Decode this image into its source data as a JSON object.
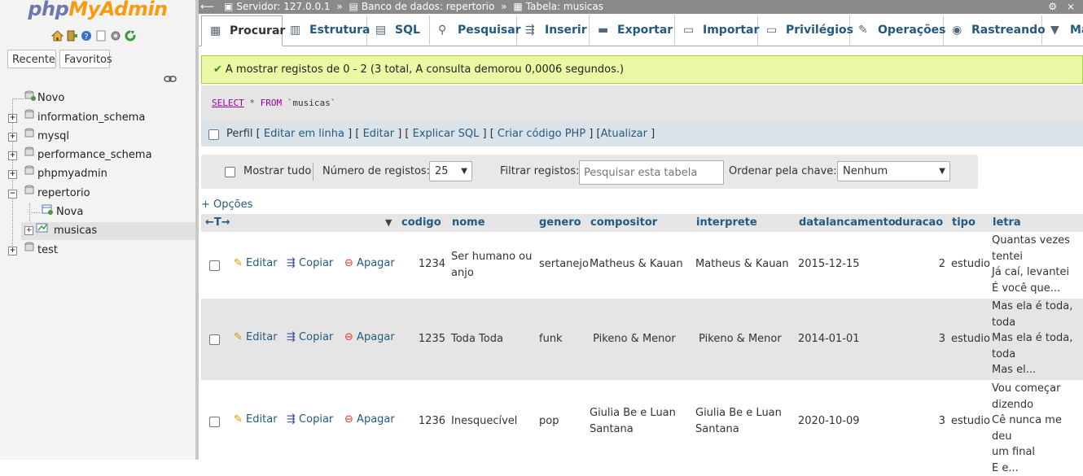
{
  "sidebar": {
    "logo_php": "php",
    "logo_myadmin": "MyAdmin",
    "recent_tab": "Recente",
    "favorites_tab": "Favoritos",
    "tree": [
      {
        "label": "Novo"
      },
      {
        "label": "information_schema"
      },
      {
        "label": "mysql"
      },
      {
        "label": "performance_schema"
      },
      {
        "label": "phpmyadmin"
      },
      {
        "label": "repertorio"
      },
      {
        "label": "Nova"
      },
      {
        "label": "musicas"
      },
      {
        "label": "test"
      }
    ]
  },
  "breadcrumb": {
    "server": "Servidor: 127.0.0.1",
    "database": "Banco de dados: repertorio",
    "table": "Tabela: musicas",
    "sep": "»"
  },
  "tabs": [
    {
      "label": "Procurar"
    },
    {
      "label": "Estrutura"
    },
    {
      "label": "SQL"
    },
    {
      "label": "Pesquisar"
    },
    {
      "label": "Inserir"
    },
    {
      "label": "Exportar"
    },
    {
      "label": "Importar"
    },
    {
      "label": "Privilégios"
    },
    {
      "label": "Operações"
    },
    {
      "label": "Rastreando"
    },
    {
      "label": "Ma"
    }
  ],
  "message": "A mostrar registos de 0 - 2 (3 total, A consulta demorou 0,0006 segundos.)",
  "sql": {
    "keyword_select": "SELECT",
    "star": "*",
    "keyword_from": "FROM",
    "table": "`musicas`"
  },
  "sqlbar": {
    "perfil": "Perfil",
    "open": "[",
    "close": "]",
    "links": [
      "Editar em linha",
      "Editar",
      "Explicar SQL",
      "Criar código PHP",
      "Atualizar"
    ]
  },
  "nav": {
    "show_all": "Mostrar tudo",
    "num_label": "Número de registos:",
    "num_value": "25",
    "filter_label": "Filtrar registos:",
    "filter_placeholder": "Pesquisar esta tabela",
    "sort_label": "Ordenar pela chave:",
    "sort_value": "Nenhum"
  },
  "options_link": "+ Opções",
  "columns": [
    "codigo",
    "nome",
    "genero",
    "compositor",
    "interprete",
    "datalancamento",
    "duracao",
    "tipo",
    "letra"
  ],
  "actions": {
    "edit": "Editar",
    "copy": "Copiar",
    "delete": "Apagar"
  },
  "rows": [
    {
      "codigo": "1234",
      "nome": [
        "Ser humano ou",
        "anjo"
      ],
      "genero": "sertanejo",
      "compositor": [
        "Matheus & Kauan"
      ],
      "interprete": [
        "Matheus & Kauan"
      ],
      "datalancamento": "2015-12-15",
      "duracao": "2",
      "tipo": "estudio",
      "letra": [
        "Quantas vezes",
        "tentei",
        "Já caí, levantei",
        "É você que..."
      ]
    },
    {
      "codigo": "1235",
      "nome": [
        "Toda Toda"
      ],
      "genero": "funk",
      "compositor": [
        " Pikeno & Menor"
      ],
      "interprete": [
        " Pikeno & Menor"
      ],
      "datalancamento": "2014-01-01",
      "duracao": "3",
      "tipo": "estudio",
      "letra": [
        "Mas ela é toda,",
        "toda",
        "Mas ela é toda,",
        "toda",
        "Mas el..."
      ]
    },
    {
      "codigo": "1236",
      "nome": [
        "Inesquecível"
      ],
      "genero": "pop",
      "compositor": [
        "Giulia Be e Luan",
        "Santana"
      ],
      "interprete": [
        "Giulia Be e Luan",
        "Santana"
      ],
      "datalancamento": "2020-10-09",
      "duracao": "3",
      "tipo": "estudio",
      "letra": [
        "Vou começar",
        "dizendo",
        "Cê nunca me deu",
        "um final",
        "E e..."
      ]
    }
  ],
  "colors": {
    "link": "#235a81",
    "success_bg": "#ebf8a4",
    "topbar_bg": "#8a8a8a",
    "logo_php": "#6c78af",
    "logo_admin": "#f89c0e"
  }
}
